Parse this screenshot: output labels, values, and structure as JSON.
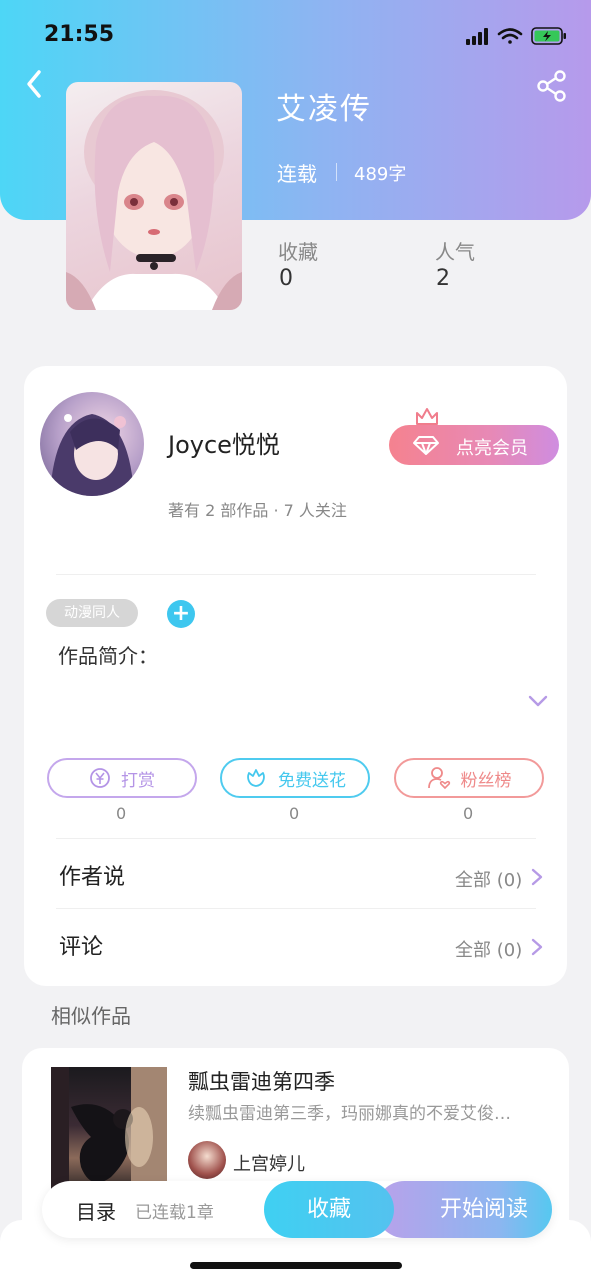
{
  "status_bar": {
    "time": "21:55"
  },
  "book": {
    "title": "艾凌传",
    "status": "连载",
    "word_count": "489字",
    "stats": [
      {
        "label": "收藏",
        "value": "0"
      },
      {
        "label": "人气",
        "value": "2"
      }
    ]
  },
  "author": {
    "name": "Joyce悦悦",
    "meta": "著有 2 部作品 · 7 人关注",
    "vip_button": "点亮会员"
  },
  "tags": [
    "动漫同人"
  ],
  "intro_label": "作品简介：",
  "actions": [
    {
      "label": "打赏",
      "count": "0",
      "color": "#b494e6"
    },
    {
      "label": "免费送花",
      "count": "0",
      "color": "#45c8ee"
    },
    {
      "label": "粉丝榜",
      "count": "0",
      "color": "#ef8a8a"
    }
  ],
  "rows": [
    {
      "title": "作者说",
      "right": "全部 (0)"
    },
    {
      "title": "评论",
      "right": "全部 (0)"
    }
  ],
  "similar": {
    "section_title": "相似作品",
    "items": [
      {
        "title": "瓢虫雷迪第四季",
        "desc": "续瓢虫雷迪第三季，玛丽娜真的不爱艾俊…",
        "author": "上宫婷儿"
      }
    ]
  },
  "bottom": {
    "toc_label": "目录",
    "toc_meta": "已连载1章",
    "collect": "收藏",
    "read": "开始阅读"
  },
  "colors": {
    "header_gradient_start": "#4dd6f6",
    "header_gradient_end": "#b69aeb",
    "accent_cyan": "#3ec7ef",
    "accent_purple": "#b494e6"
  }
}
